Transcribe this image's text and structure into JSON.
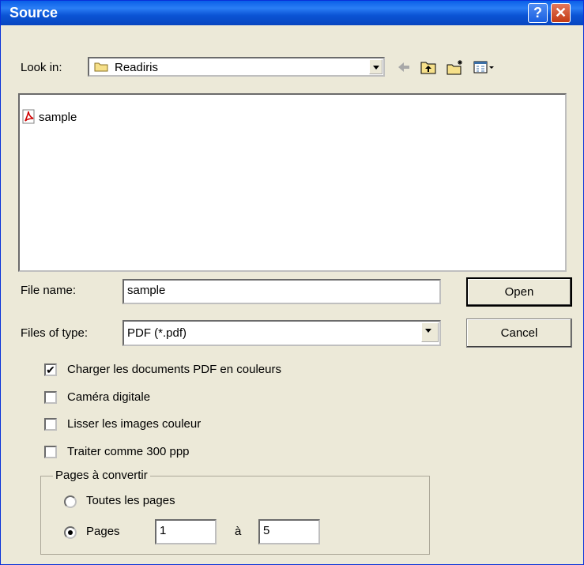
{
  "window": {
    "title": "Source"
  },
  "lookin": {
    "label": "Look in:",
    "value": "Readiris"
  },
  "toolbar": {
    "back_icon": "back-arrow-icon",
    "up_icon": "up-folder-icon",
    "new_folder_icon": "new-folder-icon",
    "view_icon": "view-menu-icon"
  },
  "files": [
    {
      "name": "sample",
      "icon": "pdf-icon"
    }
  ],
  "filename": {
    "label": "File name:",
    "value": "sample"
  },
  "filetype": {
    "label": "Files of type:",
    "value": "PDF (*.pdf)"
  },
  "buttons": {
    "open": "Open",
    "cancel": "Cancel"
  },
  "options": {
    "color_pdf": {
      "label": "Charger les documents PDF en couleurs",
      "checked": true
    },
    "digital_camera": {
      "label": "Caméra digitale",
      "checked": false
    },
    "smooth_color": {
      "label": "Lisser les images couleur",
      "checked": false
    },
    "treat_300": {
      "label": "Traiter comme 300 ppp",
      "checked": false
    }
  },
  "pages": {
    "group_label": "Pages à convertir",
    "all_label": "Toutes les pages",
    "range_label": "Pages",
    "to_label": "à",
    "from": "1",
    "to": "5",
    "selected": "range"
  },
  "colors": {
    "title_bar": "#0a53d4",
    "dialog_bg": "#ece9d8",
    "close_btn": "#c33a14"
  }
}
